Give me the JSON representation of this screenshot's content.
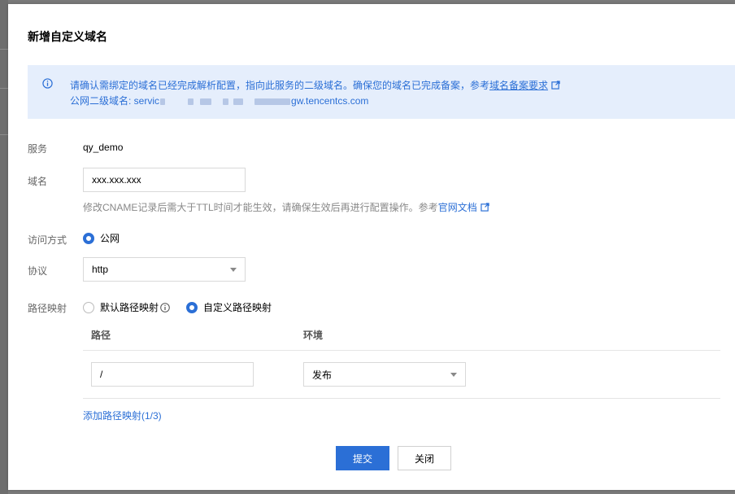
{
  "dialog": {
    "title": "新增自定义域名"
  },
  "notice": {
    "line1_text": "请确认需绑定的域名已经完成解析配置，指向此服务的二级域名。确保您的域名已完成备案，参考",
    "line1_link": "域名备案要求",
    "line2_prefix": "公网二级域名: servic",
    "line2_suffix": "gw.tencentcs.com"
  },
  "form": {
    "service": {
      "label": "服务",
      "value": "qy_demo"
    },
    "domain": {
      "label": "域名",
      "value": "xxx.xxx.xxx",
      "hint_text": "修改CNAME记录后需大于TTL时间才能生效，请确保生效后再进行配置操作。参考",
      "hint_link": "官网文档"
    },
    "access": {
      "label": "访问方式",
      "option": "公网"
    },
    "protocol": {
      "label": "协议",
      "value": "http"
    },
    "path_mapping": {
      "label": "路径映射",
      "option_default": "默认路径映射",
      "option_custom": "自定义路径映射",
      "selected": "custom",
      "columns": {
        "path": "路径",
        "env": "环境"
      },
      "rows": [
        {
          "path": "/",
          "env": "发布"
        }
      ],
      "add_link": "添加路径映射(1/3)"
    }
  },
  "footer": {
    "submit": "提交",
    "close": "关闭"
  },
  "colors": {
    "accent": "#2b6fd6",
    "notice_bg": "#e5eefc"
  }
}
